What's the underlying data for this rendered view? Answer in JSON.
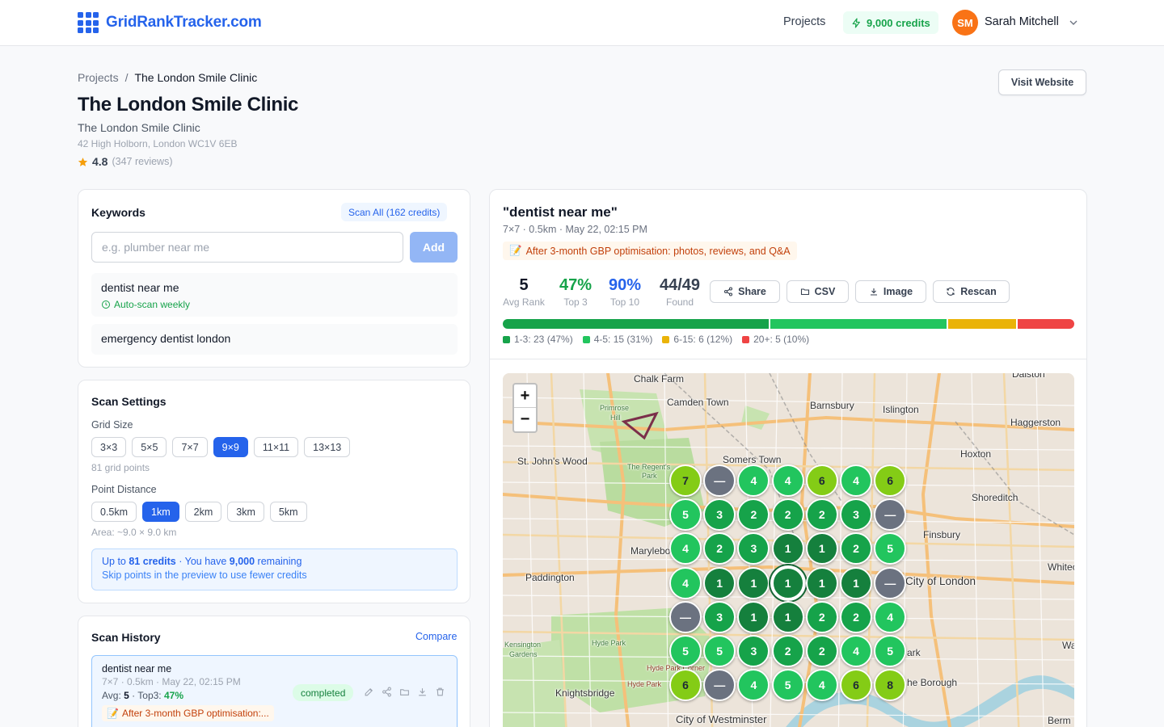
{
  "nav": {
    "brand": "GridRankTracker.com",
    "projects": "Projects",
    "credits": "9,000 credits",
    "user_initials": "SM",
    "user_name": "Sarah Mitchell"
  },
  "breadcrumb": {
    "root": "Projects",
    "separator": "/",
    "current": "The London Smile Clinic"
  },
  "business": {
    "title": "The London Smile Clinic",
    "name": "The London Smile Clinic",
    "address": "42 High Holborn, London WC1V 6EB",
    "rating": "4.8",
    "reviews": "(347 reviews)",
    "visit_label": "Visit Website"
  },
  "keywords": {
    "title": "Keywords",
    "scan_all": "Scan All (162 credits)",
    "placeholder": "e.g. plumber near me",
    "add_label": "Add",
    "items": [
      {
        "text": "dentist near me",
        "auto": "Auto-scan weekly"
      },
      {
        "text": "emergency dentist london"
      }
    ]
  },
  "scan_settings": {
    "title": "Scan Settings",
    "grid_size_label": "Grid Size",
    "grid_sizes": [
      "3×3",
      "5×5",
      "7×7",
      "9×9",
      "11×11",
      "13×13"
    ],
    "grid_selected": "9×9",
    "grid_points": "81 grid points",
    "distance_label": "Point Distance",
    "distances": [
      "0.5km",
      "1km",
      "2km",
      "3km",
      "5km"
    ],
    "distance_selected": "1km",
    "area": "Area: ~9.0 × 9.0 km",
    "credit_prefix": "Up to ",
    "credit_amount": "81 credits",
    "credit_sep": " · ",
    "credit_have": "You have ",
    "credit_remaining": "9,000",
    "credit_suffix": " remaining",
    "credit_hint": "Skip points in the preview to use fewer credits"
  },
  "history": {
    "title": "Scan History",
    "compare": "Compare",
    "item": {
      "keyword": "dentist near me",
      "meta": "7×7 · 0.5km · May 22, 02:15 PM",
      "avg_label": "Avg: ",
      "avg": "5",
      "top3_label": " · Top3: ",
      "top3": "47%",
      "note": "After 3-month GBP optimisation:...",
      "status": "completed"
    }
  },
  "result": {
    "keyword": "\"dentist near me\"",
    "meta": "7×7 · 0.5km · May 22, 02:15 PM",
    "note": "After 3-month GBP optimisation: photos, reviews, and Q&A",
    "stats": [
      {
        "value": "5",
        "label": "Avg Rank",
        "color": "#111827"
      },
      {
        "value": "47%",
        "label": "Top 3",
        "color": "#16a34a"
      },
      {
        "value": "90%",
        "label": "Top 10",
        "color": "#2563eb"
      },
      {
        "value": "44/49",
        "label": "Found",
        "color": "#374151"
      }
    ],
    "actions": {
      "share": "Share",
      "csv": "CSV",
      "image": "Image",
      "rescan": "Rescan"
    },
    "distribution": [
      {
        "label": "1-3: 23 (47%)",
        "percent": 47,
        "color": "#16a34a"
      },
      {
        "label": "4-5: 15 (31%)",
        "percent": 31,
        "color": "#22c55e"
      },
      {
        "label": "6-15: 6 (12%)",
        "percent": 12,
        "color": "#eab308"
      },
      {
        "label": "20+: 5 (10%)",
        "percent": 10,
        "color": "#ef4444"
      }
    ]
  },
  "map": {
    "zoom_in": "+",
    "zoom_out": "−",
    "labels": {
      "chalk_farm": "Chalk Farm",
      "camden": "Camden Town",
      "barnsbury": "Barnsbury",
      "islington": "Islington",
      "dalston": "Dalston",
      "haggerston": "Haggerston",
      "primrose": "Primrose",
      "hill": "Hill",
      "stjohns": "St. John's Wood",
      "regents": "The Regent's",
      "park": "Park",
      "somers": "Somers Town",
      "hoxton": "Hoxton",
      "shoreditch": "Shoreditch",
      "finsbury": "Finsbury",
      "marylebone": "Marylebo",
      "paddington": "Paddington",
      "city": "City of London",
      "whitechapel": "Whitech",
      "kensington": "Kensington",
      "gardens": "Gardens",
      "hydepark": "Hyde Park",
      "hydecorner": "Hyde Park Corner",
      "hydepk": "Hyde Park",
      "knightsbridge": "Knightsbridge",
      "borough": "he Borough",
      "westminster": "City of Westminster",
      "bermondsey": "Berm",
      "ark": "ark",
      "wa": "Wa"
    },
    "ranks": [
      [
        "7",
        "—",
        "4",
        "4",
        "6",
        "4",
        "6"
      ],
      [
        "5",
        "3",
        "2",
        "2",
        "2",
        "3",
        "—"
      ],
      [
        "4",
        "2",
        "3",
        "1",
        "1",
        "2",
        "5"
      ],
      [
        "4",
        "1",
        "1",
        "1",
        "1",
        "1",
        "—"
      ],
      [
        "—",
        "3",
        "1",
        "1",
        "2",
        "2",
        "4"
      ],
      [
        "5",
        "5",
        "3",
        "2",
        "2",
        "4",
        "5"
      ],
      [
        "6",
        "—",
        "4",
        "5",
        "4",
        "6",
        "8"
      ]
    ],
    "rank_colors": {
      "top": "#15803d",
      "good": "#16a34a",
      "mid": "#22c55e",
      "low": "#84cc16",
      "none": "#6b7280"
    }
  }
}
